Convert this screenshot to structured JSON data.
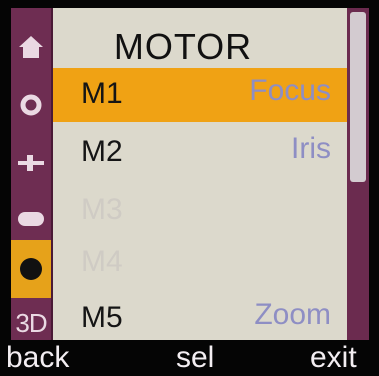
{
  "screen": {
    "title": "MOTOR"
  },
  "rail": {
    "items": [
      {
        "icon": "home-icon"
      },
      {
        "icon": "circle-outline-icon"
      },
      {
        "icon": "slider-icon"
      },
      {
        "icon": "pill-icon"
      },
      {
        "icon": "filled-dot-icon",
        "active": true
      },
      {
        "label": "3D"
      }
    ]
  },
  "motors": [
    {
      "code": "M1",
      "name": "Focus",
      "state": "selected"
    },
    {
      "code": "M2",
      "name": "Iris",
      "state": "normal"
    },
    {
      "code": "M3",
      "name": "",
      "state": "disabled"
    },
    {
      "code": "M4",
      "name": "",
      "state": "disabled"
    },
    {
      "code": "M5",
      "name": "Zoom",
      "state": "normal"
    }
  ],
  "softkeys": {
    "back": "back",
    "sel": "sel",
    "exit": "exit"
  },
  "colors": {
    "rail": "#6e2d52",
    "selection": "#f0a214",
    "panel": "#dcd9cc",
    "motor_name": "#8e8ec4",
    "disabled_text": "#cfcbc4",
    "softkey_bar": "#050505"
  },
  "scroll": {
    "visible_fraction": 0.52
  }
}
